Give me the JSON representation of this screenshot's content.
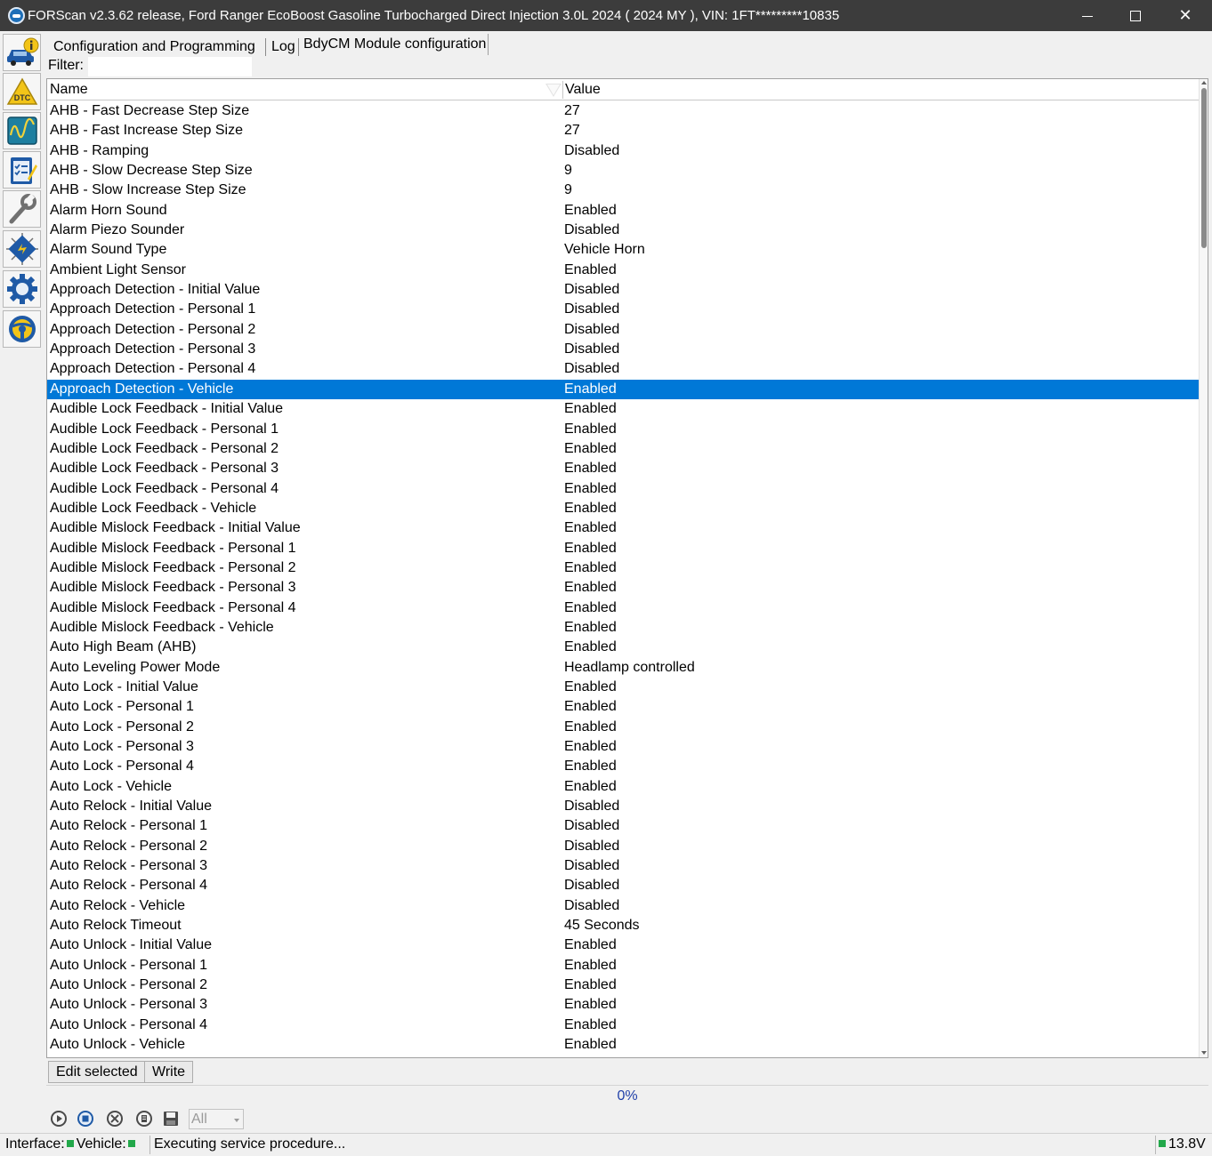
{
  "window": {
    "title": "FORScan v2.3.62 release, Ford Ranger EcoBoost Gasoline Turbocharged Direct Injection 3.0L 2024 ( 2024 MY ), VIN: 1FT*********10835"
  },
  "toolbar": {
    "items": [
      {
        "name": "vehicle-info",
        "icon": "car-info-icon"
      },
      {
        "name": "dtc",
        "icon": "dtc-warning-icon",
        "label": "DTC"
      },
      {
        "name": "oscilloscope",
        "icon": "oscilloscope-icon"
      },
      {
        "name": "tests",
        "icon": "checklist-icon"
      },
      {
        "name": "service",
        "icon": "wrench-icon"
      },
      {
        "name": "module-config",
        "icon": "chip-icon"
      },
      {
        "name": "settings",
        "icon": "gear-icon"
      },
      {
        "name": "help",
        "icon": "lifebuoy-icon"
      }
    ]
  },
  "tabs": [
    {
      "label": "Configuration and Programming"
    },
    {
      "label": "Log"
    },
    {
      "label": "BdyCM Module configuration"
    }
  ],
  "filter": {
    "label": "Filter:",
    "value": ""
  },
  "grid": {
    "columns": {
      "name": "Name",
      "value": "Value"
    },
    "selected_index": 14,
    "rows": [
      {
        "name": "AHB - Fast Decrease Step Size",
        "value": "27"
      },
      {
        "name": "AHB - Fast Increase Step Size",
        "value": "27"
      },
      {
        "name": "AHB - Ramping",
        "value": "Disabled"
      },
      {
        "name": "AHB - Slow Decrease Step Size",
        "value": "9"
      },
      {
        "name": "AHB - Slow Increase Step Size",
        "value": "9"
      },
      {
        "name": "Alarm Horn Sound",
        "value": "Enabled"
      },
      {
        "name": "Alarm Piezo Sounder",
        "value": "Disabled"
      },
      {
        "name": "Alarm Sound Type",
        "value": "Vehicle Horn"
      },
      {
        "name": "Ambient Light Sensor",
        "value": "Enabled"
      },
      {
        "name": "Approach Detection - Initial Value",
        "value": "Disabled"
      },
      {
        "name": "Approach Detection - Personal 1",
        "value": "Disabled"
      },
      {
        "name": "Approach Detection - Personal 2",
        "value": "Disabled"
      },
      {
        "name": "Approach Detection - Personal 3",
        "value": "Disabled"
      },
      {
        "name": "Approach Detection - Personal 4",
        "value": "Disabled"
      },
      {
        "name": "Approach Detection - Vehicle",
        "value": "Enabled"
      },
      {
        "name": "Audible Lock Feedback - Initial Value",
        "value": "Enabled"
      },
      {
        "name": "Audible Lock Feedback - Personal 1",
        "value": "Enabled"
      },
      {
        "name": "Audible Lock Feedback - Personal 2",
        "value": "Enabled"
      },
      {
        "name": "Audible Lock Feedback - Personal 3",
        "value": "Enabled"
      },
      {
        "name": "Audible Lock Feedback - Personal 4",
        "value": "Enabled"
      },
      {
        "name": "Audible Lock Feedback - Vehicle",
        "value": "Enabled"
      },
      {
        "name": "Audible Mislock Feedback - Initial Value",
        "value": "Enabled"
      },
      {
        "name": "Audible Mislock Feedback - Personal 1",
        "value": "Enabled"
      },
      {
        "name": "Audible Mislock Feedback - Personal 2",
        "value": "Enabled"
      },
      {
        "name": "Audible Mislock Feedback - Personal 3",
        "value": "Enabled"
      },
      {
        "name": "Audible Mislock Feedback - Personal 4",
        "value": "Enabled"
      },
      {
        "name": "Audible Mislock Feedback - Vehicle",
        "value": "Enabled"
      },
      {
        "name": "Auto High Beam (AHB)",
        "value": "Enabled"
      },
      {
        "name": "Auto Leveling Power Mode",
        "value": "Headlamp controlled"
      },
      {
        "name": "Auto Lock - Initial Value",
        "value": "Enabled"
      },
      {
        "name": "Auto Lock - Personal 1",
        "value": "Enabled"
      },
      {
        "name": "Auto Lock - Personal 2",
        "value": "Enabled"
      },
      {
        "name": "Auto Lock - Personal 3",
        "value": "Enabled"
      },
      {
        "name": "Auto Lock - Personal 4",
        "value": "Enabled"
      },
      {
        "name": "Auto Lock - Vehicle",
        "value": "Enabled"
      },
      {
        "name": "Auto Relock - Initial Value",
        "value": "Disabled"
      },
      {
        "name": "Auto Relock - Personal 1",
        "value": "Disabled"
      },
      {
        "name": "Auto Relock - Personal 2",
        "value": "Disabled"
      },
      {
        "name": "Auto Relock - Personal 3",
        "value": "Disabled"
      },
      {
        "name": "Auto Relock - Personal 4",
        "value": "Disabled"
      },
      {
        "name": "Auto Relock - Vehicle",
        "value": "Disabled"
      },
      {
        "name": "Auto Relock Timeout",
        "value": "45 Seconds"
      },
      {
        "name": "Auto Unlock - Initial Value",
        "value": "Enabled"
      },
      {
        "name": "Auto Unlock - Personal 1",
        "value": "Enabled"
      },
      {
        "name": "Auto Unlock - Personal 2",
        "value": "Enabled"
      },
      {
        "name": "Auto Unlock - Personal 3",
        "value": "Enabled"
      },
      {
        "name": "Auto Unlock - Personal 4",
        "value": "Enabled"
      },
      {
        "name": "Auto Unlock - Vehicle",
        "value": "Enabled"
      }
    ]
  },
  "actions": {
    "edit_label": "Edit selected",
    "write_label": "Write"
  },
  "progress": {
    "text": "0%"
  },
  "controls": {
    "icons": [
      "play-icon",
      "stop-icon",
      "clear-icon",
      "erase-icon",
      "save-icon"
    ],
    "select_value": "All"
  },
  "status": {
    "interface_label": "Interface:",
    "vehicle_label": "Vehicle:",
    "message": "Executing service procedure...",
    "voltage": "13.8V",
    "ok_color": "#22a84a"
  },
  "colors": {
    "selection": "#0078d7",
    "titlebar": "#3c3c3c",
    "progress_text": "#1f3fa8"
  }
}
